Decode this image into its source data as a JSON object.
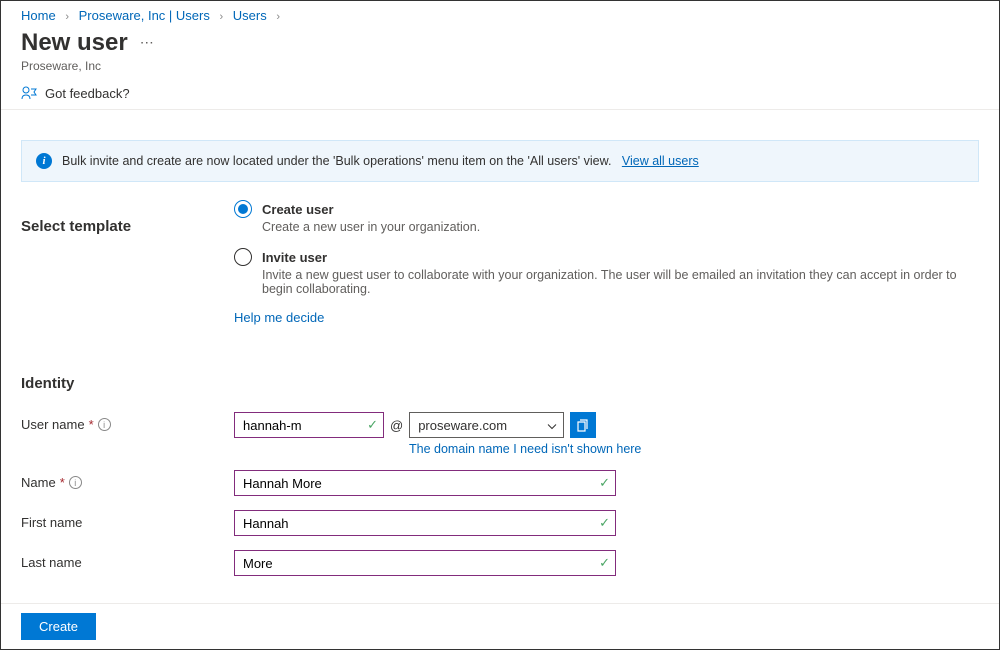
{
  "breadcrumb": {
    "items": [
      "Home",
      "Proseware, Inc | Users",
      "Users"
    ]
  },
  "header": {
    "title": "New user",
    "subtitle": "Proseware, Inc"
  },
  "feedback": {
    "label": "Got feedback?"
  },
  "banner": {
    "text": "Bulk invite and create are now located under the 'Bulk operations' menu item on the 'All users' view.",
    "link": "View all users"
  },
  "template": {
    "section_title": "Select template",
    "options": [
      {
        "label": "Create user",
        "desc": "Create a new user in your organization.",
        "selected": true
      },
      {
        "label": "Invite user",
        "desc": "Invite a new guest user to collaborate with your organization. The user will be emailed an invitation they can accept in order to begin collaborating.",
        "selected": false
      }
    ],
    "help_link": "Help me decide"
  },
  "identity": {
    "section_title": "Identity",
    "username_label": "User name",
    "username_value": "hannah-m",
    "at": "@",
    "domain_value": "proseware.com",
    "domain_hint": "The domain name I need isn't shown here",
    "name_label": "Name",
    "name_value": "Hannah More",
    "firstname_label": "First name",
    "firstname_value": "Hannah",
    "lastname_label": "Last name",
    "lastname_value": "More"
  },
  "footer": {
    "create_label": "Create"
  }
}
